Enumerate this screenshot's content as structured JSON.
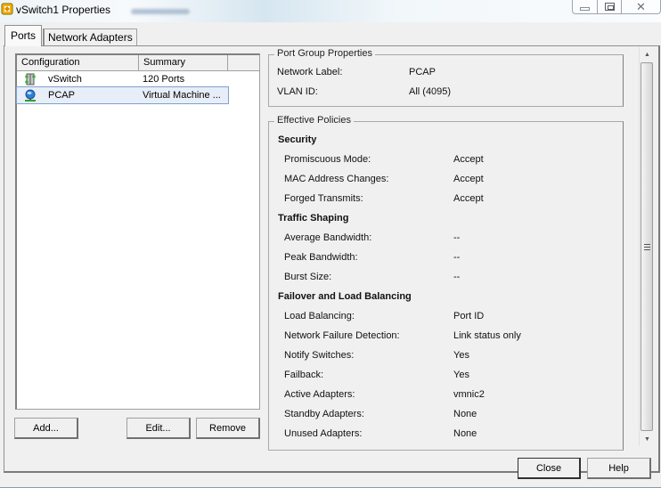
{
  "window": {
    "title": "vSwitch1 Properties",
    "controls": {
      "minimize": "minimize",
      "maximize": "maximize",
      "close": "close"
    }
  },
  "tabs": [
    {
      "label": "Ports",
      "active": true
    },
    {
      "label": "Network Adapters",
      "active": false
    }
  ],
  "ports_list": {
    "columns": [
      "Configuration",
      "Summary",
      ""
    ],
    "rows": [
      {
        "icon": "vswitch-icon",
        "name": "vSwitch",
        "summary": "120 Ports",
        "selected": false
      },
      {
        "icon": "vm-portgroup-icon",
        "name": "PCAP",
        "summary": "Virtual Machine ...",
        "selected": true
      }
    ]
  },
  "list_buttons": {
    "add": "Add...",
    "edit": "Edit...",
    "remove": "Remove"
  },
  "port_group_properties": {
    "title": "Port Group Properties",
    "items": [
      {
        "label": "Network Label:",
        "value": "PCAP"
      },
      {
        "label": "VLAN ID:",
        "value": "All (4095)"
      }
    ]
  },
  "effective_policies": {
    "title": "Effective Policies",
    "sections": [
      {
        "heading": "Security",
        "items": [
          {
            "label": "Promiscuous Mode:",
            "value": "Accept"
          },
          {
            "label": "MAC Address Changes:",
            "value": "Accept"
          },
          {
            "label": "Forged Transmits:",
            "value": "Accept"
          }
        ]
      },
      {
        "heading": "Traffic Shaping",
        "items": [
          {
            "label": "Average Bandwidth:",
            "value": "--"
          },
          {
            "label": "Peak Bandwidth:",
            "value": "--"
          },
          {
            "label": "Burst Size:",
            "value": "--"
          }
        ]
      },
      {
        "heading": "Failover and Load Balancing",
        "items": [
          {
            "label": "Load Balancing:",
            "value": "Port ID"
          },
          {
            "label": "Network Failure Detection:",
            "value": "Link status only"
          },
          {
            "label": "Notify Switches:",
            "value": "Yes"
          },
          {
            "label": "Failback:",
            "value": "Yes"
          },
          {
            "label": "Active Adapters:",
            "value": "vmnic2"
          },
          {
            "label": "Standby Adapters:",
            "value": "None"
          },
          {
            "label": "Unused Adapters:",
            "value": "None"
          }
        ]
      }
    ]
  },
  "dialog_buttons": {
    "close": "Close",
    "help": "Help"
  },
  "colors": {
    "selection_bg": "#e8eef7",
    "selection_border": "#7da2ce",
    "dialog_bg": "#f0f0f0"
  }
}
